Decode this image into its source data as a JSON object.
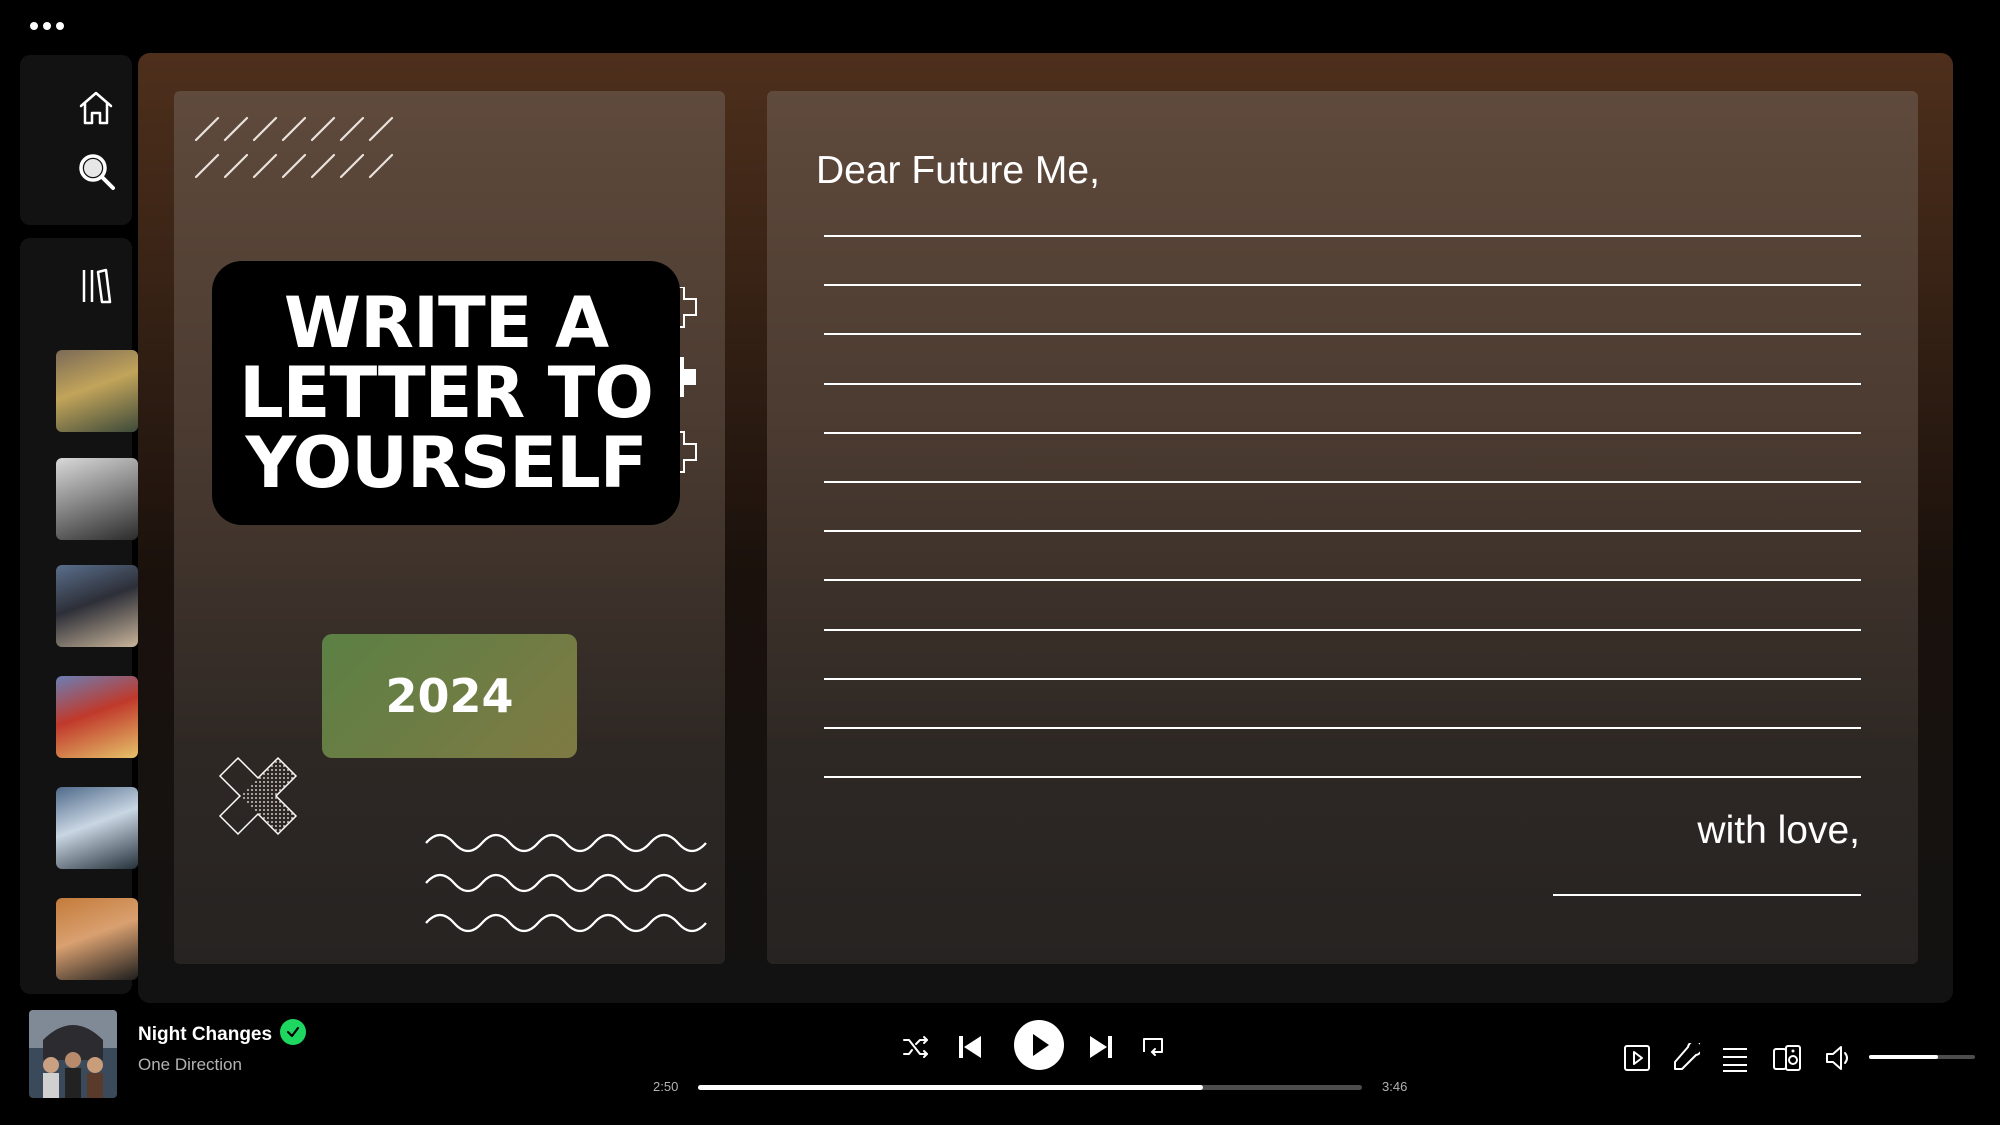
{
  "app": {
    "menu_icon": "more-dots-icon"
  },
  "sidebar": {
    "nav": [
      {
        "name": "home",
        "icon": "home-icon"
      },
      {
        "name": "search",
        "icon": "search-icon"
      }
    ],
    "library_icon": "library-icon",
    "playlists": [
      {
        "id": "playlist-1",
        "colors": [
          "#7b6a57",
          "#c2a45a",
          "#3d4a3a"
        ]
      },
      {
        "id": "playlist-2",
        "colors": [
          "#d9d9d9",
          "#8c8c8c",
          "#2b2b2b"
        ]
      },
      {
        "id": "playlist-3",
        "colors": [
          "#5a6f8c",
          "#2d2f38",
          "#c9b59a"
        ]
      },
      {
        "id": "playlist-4",
        "colors": [
          "#6a7fb5",
          "#c0392b",
          "#e6c36a"
        ]
      },
      {
        "id": "playlist-5",
        "colors": [
          "#4f6a8a",
          "#c9d6e3",
          "#24313b"
        ]
      },
      {
        "id": "playlist-6",
        "colors": [
          "#c47b3a",
          "#d9a070",
          "#1e1e1e"
        ]
      }
    ]
  },
  "letter": {
    "title": "WRITE A\nLETTER TO\nYOURSELF",
    "year": "2024",
    "greeting": "Dear Future Me,",
    "signoff": "with love,",
    "line_count": 12
  },
  "player": {
    "song_title": "Night Changes",
    "artist": "One Direction",
    "liked": true,
    "elapsed": "2:50",
    "duration": "3:46",
    "progress": 0.76,
    "volume": 0.65,
    "controls": {
      "shuffle": "shuffle-icon",
      "previous": "previous-icon",
      "play": "play-icon",
      "next": "next-icon",
      "repeat": "repeat-icon"
    },
    "right_controls": [
      "now-playing-view-icon",
      "lyrics-icon",
      "queue-icon",
      "connect-device-icon",
      "volume-icon"
    ]
  }
}
